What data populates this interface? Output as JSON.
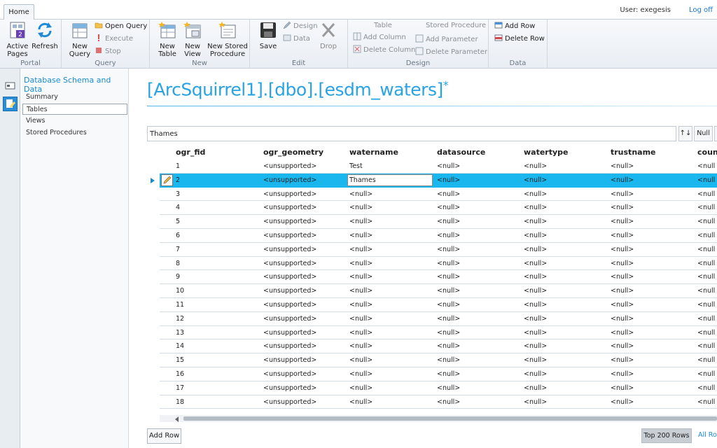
{
  "tabs": [
    "Home"
  ],
  "user_label": "User: exegesis",
  "logoff_label": "Log off",
  "ribbon": {
    "portal": {
      "label": "Portal",
      "active_pages": "Active\nPages",
      "refresh": "Refresh",
      "badge": "2"
    },
    "query": {
      "label": "Query",
      "new_query": "New\nQuery",
      "open_query": "Open Query",
      "execute": "Execute",
      "stop": "Stop"
    },
    "new": {
      "label": "New",
      "new_table": "New\nTable",
      "new_view": "New\nView",
      "new_sp": "New Stored\nProcedure"
    },
    "edit": {
      "label": "Edit",
      "save": "Save",
      "design": "Design",
      "data": "Data",
      "drop": "Drop"
    },
    "design": {
      "label": "Design",
      "table_hdr": "Table",
      "add_column": "Add Column",
      "delete_column": "Delete Column",
      "sp_hdr": "Stored Procedure",
      "add_parameter": "Add Parameter",
      "delete_parameter": "Delete Parameter"
    },
    "data": {
      "label": "Data",
      "add_row": "Add Row",
      "delete_row": "Delete Row"
    }
  },
  "sidenav": {
    "title": "Database Schema and Data",
    "items": [
      "Summary",
      "Tables",
      "Views",
      "Stored Procedures"
    ],
    "active": "Tables"
  },
  "main": {
    "title": "[ArcSquirrel1].[dbo].[esdm_waters]",
    "modified_marker": "*",
    "filter_value": "Thames",
    "sort_label": "↑↓",
    "null_label": "Null"
  },
  "grid": {
    "columns": [
      "ogr_fid",
      "ogr_geometry",
      "watername",
      "datasource",
      "watertype",
      "trustname",
      "count"
    ],
    "rows": [
      [
        "1",
        "<unsupported>",
        "Test",
        "<null>",
        "<null>",
        "<null>",
        "<null"
      ],
      [
        "2",
        "<unsupported>",
        "Thames",
        "<null>",
        "<null>",
        "<null>",
        "<null"
      ],
      [
        "3",
        "<unsupported>",
        "<null>",
        "<null>",
        "<null>",
        "<null>",
        "<null"
      ],
      [
        "4",
        "<unsupported>",
        "<null>",
        "<null>",
        "<null>",
        "<null>",
        "<null"
      ],
      [
        "5",
        "<unsupported>",
        "<null>",
        "<null>",
        "<null>",
        "<null>",
        "<null"
      ],
      [
        "6",
        "<unsupported>",
        "<null>",
        "<null>",
        "<null>",
        "<null>",
        "<null"
      ],
      [
        "7",
        "<unsupported>",
        "<null>",
        "<null>",
        "<null>",
        "<null>",
        "<null"
      ],
      [
        "8",
        "<unsupported>",
        "<null>",
        "<null>",
        "<null>",
        "<null>",
        "<null"
      ],
      [
        "9",
        "<unsupported>",
        "<null>",
        "<null>",
        "<null>",
        "<null>",
        "<null"
      ],
      [
        "10",
        "<unsupported>",
        "<null>",
        "<null>",
        "<null>",
        "<null>",
        "<null"
      ],
      [
        "11",
        "<unsupported>",
        "<null>",
        "<null>",
        "<null>",
        "<null>",
        "<null"
      ],
      [
        "12",
        "<unsupported>",
        "<null>",
        "<null>",
        "<null>",
        "<null>",
        "<null"
      ],
      [
        "13",
        "<unsupported>",
        "<null>",
        "<null>",
        "<null>",
        "<null>",
        "<null"
      ],
      [
        "14",
        "<unsupported>",
        "<null>",
        "<null>",
        "<null>",
        "<null>",
        "<null"
      ],
      [
        "15",
        "<unsupported>",
        "<null>",
        "<null>",
        "<null>",
        "<null>",
        "<null"
      ],
      [
        "16",
        "<unsupported>",
        "<null>",
        "<null>",
        "<null>",
        "<null>",
        "<null"
      ],
      [
        "17",
        "<unsupported>",
        "<null>",
        "<null>",
        "<null>",
        "<null>",
        "<null"
      ],
      [
        "18",
        "<unsupported>",
        "<null>",
        "<null>",
        "<null>",
        "<null>",
        "<null"
      ]
    ],
    "selected_row": "2",
    "editing_column": "watername"
  },
  "footer": {
    "add_row": "Add Row",
    "top_rows": "Top 200 Rows",
    "all_rows": "All Ro"
  },
  "colors": {
    "accent": "#29a3e3",
    "selected_row": "#19b7ee",
    "link": "#1976d2"
  }
}
